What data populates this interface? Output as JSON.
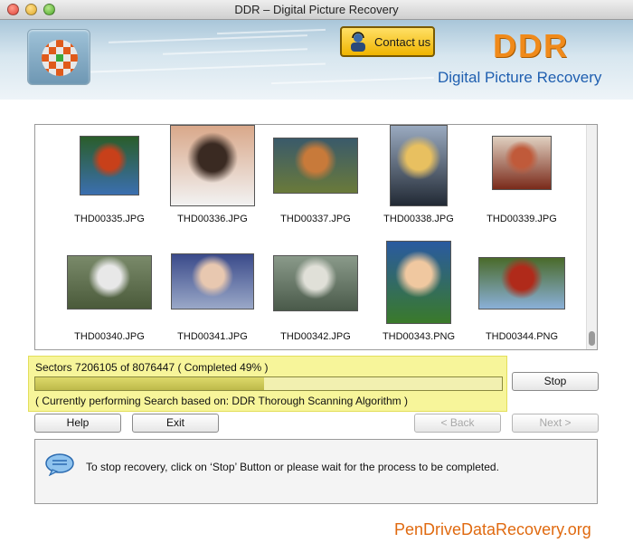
{
  "window": {
    "title": "DDR – Digital Picture Recovery"
  },
  "header": {
    "contact_label": "Contact us",
    "brand": "DDR",
    "product_name": "Digital Picture Recovery",
    "accent_color": "#f08a1a",
    "title_color": "#1f5fb0"
  },
  "thumbnails": [
    {
      "name": "THD00335.JPG",
      "colors": [
        "#3b6fb0",
        "#c8401a",
        "#2a5d2a"
      ]
    },
    {
      "name": "THD00336.JPG",
      "colors": [
        "#f2f2f2",
        "#3a2a22",
        "#d9a88a"
      ]
    },
    {
      "name": "THD00337.JPG",
      "colors": [
        "#6a7a3a",
        "#c87a3a",
        "#3a5a6a"
      ]
    },
    {
      "name": "THD00338.JPG",
      "colors": [
        "#222a35",
        "#e8c060",
        "#9aaac0"
      ]
    },
    {
      "name": "THD00339.JPG",
      "colors": [
        "#7a2a1a",
        "#c05a3a",
        "#e0d0c0"
      ]
    },
    {
      "name": "THD00340.JPG",
      "colors": [
        "#4a5a3a",
        "#e8e8e8",
        "#7a8a6a"
      ]
    },
    {
      "name": "THD00341.JPG",
      "colors": [
        "#9aa8c8",
        "#e8c8b0",
        "#3a4a8a"
      ]
    },
    {
      "name": "THD00342.JPG",
      "colors": [
        "#4a5a4a",
        "#e0e0d8",
        "#8a9a8a"
      ]
    },
    {
      "name": "THD00343.PNG",
      "colors": [
        "#3a7a2a",
        "#f0c8a0",
        "#2a5aa0"
      ]
    },
    {
      "name": "THD00344.PNG",
      "colors": [
        "#8ab0d8",
        "#b02a1a",
        "#4a6a2a"
      ]
    }
  ],
  "progress": {
    "sectors_text": "Sectors 7206105 of 8076447   ( Completed 49% )",
    "percent": 49,
    "algorithm_text": "( Currently performing Search based on: DDR Thorough Scanning Algorithm )"
  },
  "buttons": {
    "stop": "Stop",
    "help": "Help",
    "exit": "Exit",
    "back": "< Back",
    "next": "Next >"
  },
  "info": {
    "message": "To stop recovery, click on ‘Stop’ Button or please wait for the process to be completed."
  },
  "footer": {
    "url": "PenDriveDataRecovery.org"
  }
}
